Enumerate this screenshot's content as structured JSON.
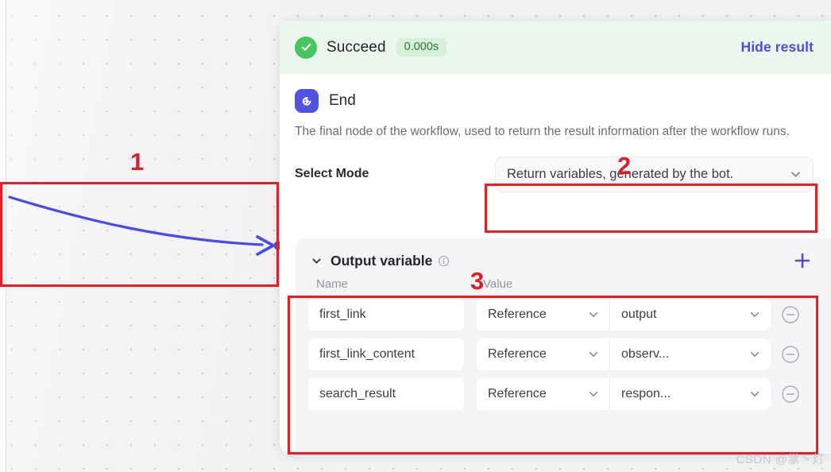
{
  "canvas": {
    "connector_name": "workflow-connector-arrow"
  },
  "panel": {
    "status": {
      "icon": "check-circle-icon",
      "label": "Succeed",
      "duration": "0.000s"
    },
    "hide_result_label": "Hide result",
    "node": {
      "icon": "end-node-icon",
      "title": "End",
      "description": "The final node of the workflow, used to return the result information after the workflow runs."
    },
    "select_mode": {
      "label": "Select Mode",
      "value": "Return variables, generated by the bot.",
      "chevron": "chevron-down-icon"
    },
    "output_variable": {
      "caret": "chevron-down-icon",
      "title": "Output variable",
      "info_icon": "info-circle-icon",
      "add_icon": "plus-icon",
      "columns": {
        "name": "Name",
        "value": "Value"
      },
      "rows": [
        {
          "name": "first_link",
          "type": "Reference",
          "reference": "output",
          "remove_icon": "minus-circle-icon"
        },
        {
          "name": "first_link_content",
          "type": "Reference",
          "reference": "observ...",
          "remove_icon": "minus-circle-icon"
        },
        {
          "name": "search_result",
          "type": "Reference",
          "reference": "respon...",
          "remove_icon": "minus-circle-icon"
        }
      ]
    }
  },
  "annotations": {
    "colors": {
      "red": "#ee1b24",
      "accent": "#4f52e3",
      "success": "#46c560"
    },
    "markers": [
      {
        "id": "1",
        "label": "1"
      },
      {
        "id": "2",
        "label": "2"
      },
      {
        "id": "3",
        "label": "3"
      }
    ]
  },
  "watermark": "CSDN @掌丶灯"
}
